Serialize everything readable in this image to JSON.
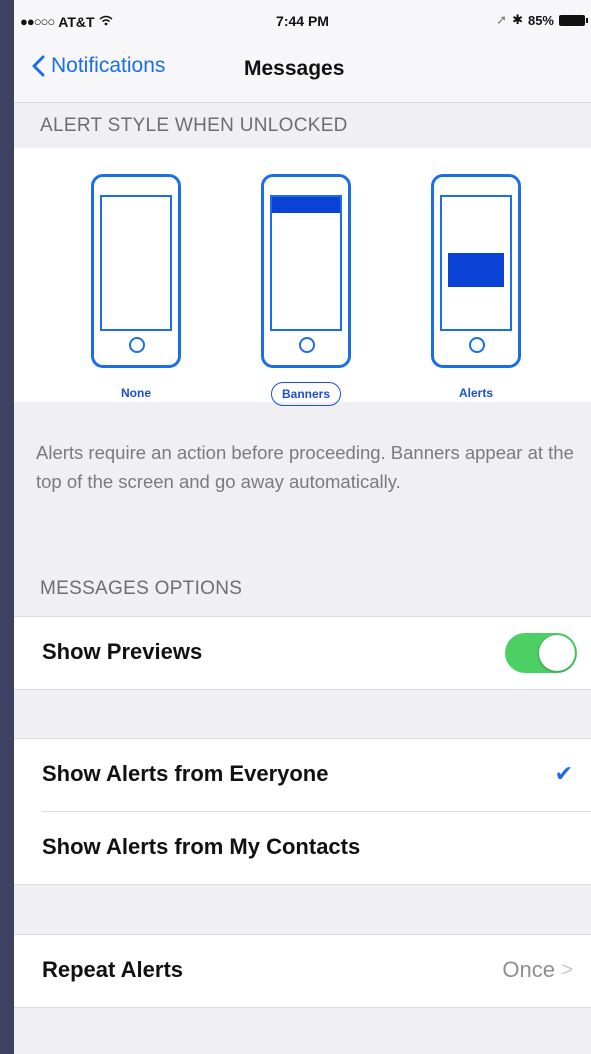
{
  "status_bar": {
    "carrier": "AT&T",
    "time": "7:44 PM",
    "battery_percent": "85%"
  },
  "nav": {
    "back_label": "Notifications",
    "title": "Messages"
  },
  "alert_style": {
    "header": "ALERT STYLE WHEN UNLOCKED",
    "options": [
      {
        "label": "None",
        "selected": false
      },
      {
        "label": "Banners",
        "selected": true
      },
      {
        "label": "Alerts",
        "selected": false
      }
    ],
    "footer": "Alerts require an action before proceeding. Banners appear at the top of the screen and go away automatically."
  },
  "messages_options": {
    "header": "MESSAGES OPTIONS",
    "show_previews": {
      "label": "Show Previews",
      "enabled": true
    }
  },
  "alerts_from": [
    {
      "label": "Show Alerts from Everyone",
      "checked": true
    },
    {
      "label": "Show Alerts from My Contacts",
      "checked": false
    }
  ],
  "repeat_alerts": {
    "label": "Repeat Alerts",
    "value": "Once"
  },
  "colors": {
    "accent": "#1a6ee8",
    "toggle_on": "#4cd064",
    "selection_blue": "#0a42d6"
  }
}
